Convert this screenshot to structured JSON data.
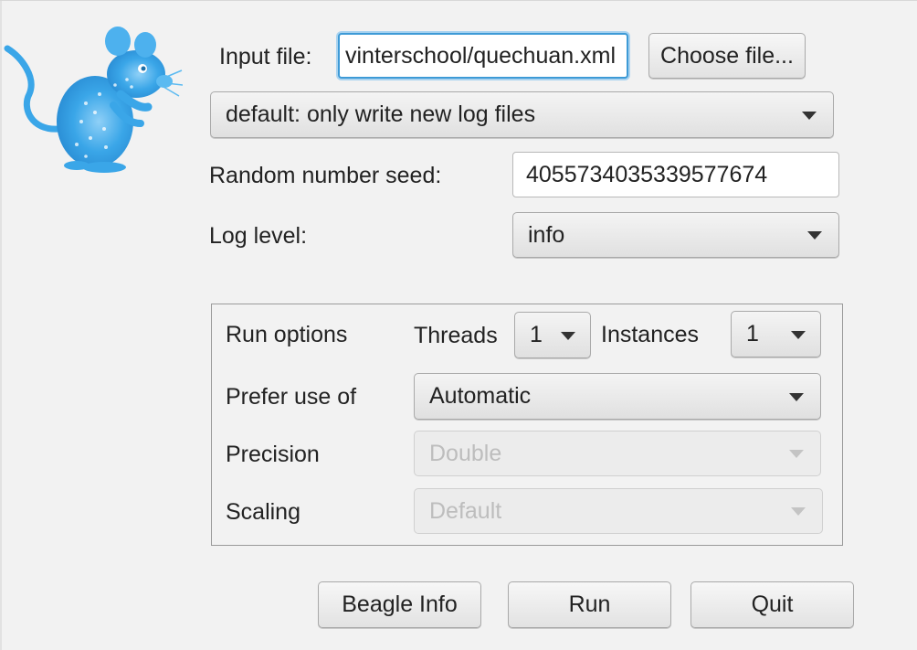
{
  "input_file": {
    "label": "Input file:",
    "value": "vinterschool/quechuan.xml",
    "choose_button": "Choose file..."
  },
  "log_mode": {
    "selected": "default: only write new log files"
  },
  "seed": {
    "label": "Random number seed:",
    "value": "4055734035339577674"
  },
  "log_level": {
    "label": "Log level:",
    "selected": "info"
  },
  "run_options": {
    "label": "Run options",
    "threads_label": "Threads",
    "threads_value": "1",
    "instances_label": "Instances",
    "instances_value": "1",
    "prefer_label": "Prefer use of",
    "prefer_value": "Automatic",
    "precision_label": "Precision",
    "precision_value": "Double",
    "scaling_label": "Scaling",
    "scaling_value": "Default"
  },
  "buttons": {
    "beagle_info": "Beagle Info",
    "run": "Run",
    "quit": "Quit"
  },
  "colors": {
    "focus_ring": "#3d9ad6",
    "logo_blue": "#3aa6e8"
  },
  "icons": {
    "logo": "beast-mouse-logo"
  }
}
